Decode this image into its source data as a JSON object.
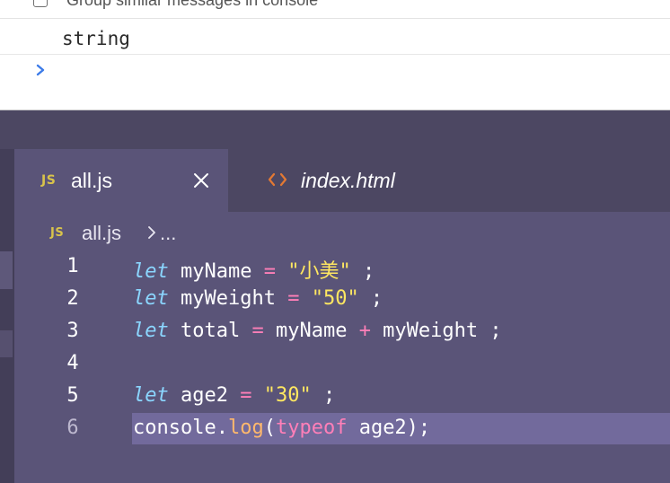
{
  "console": {
    "group_similar_label": "Group similar messages in console",
    "output_text": "string"
  },
  "editor": {
    "tabs": [
      {
        "badge": "JS",
        "label": "all.js",
        "active": true
      },
      {
        "label": "index.html",
        "active": false
      }
    ],
    "breadcrumb": {
      "badge": "JS",
      "file": "all.js",
      "more": "..."
    },
    "lines": [
      {
        "number": "1",
        "tokens": [
          {
            "t": "let",
            "c": "kw"
          },
          {
            "t": " myName ",
            "c": "plain"
          },
          {
            "t": "=",
            "c": "op"
          },
          {
            "t": " ",
            "c": "plain"
          },
          {
            "t": "\"小美\"",
            "c": "str"
          },
          {
            "t": " ;",
            "c": "plain"
          }
        ]
      },
      {
        "number": "2",
        "tokens": [
          {
            "t": "let",
            "c": "kw"
          },
          {
            "t": " myWeight ",
            "c": "plain"
          },
          {
            "t": "=",
            "c": "op"
          },
          {
            "t": " ",
            "c": "plain"
          },
          {
            "t": "\"50\"",
            "c": "str"
          },
          {
            "t": " ;",
            "c": "plain"
          }
        ]
      },
      {
        "number": "3",
        "tokens": [
          {
            "t": "let",
            "c": "kw"
          },
          {
            "t": " total ",
            "c": "plain"
          },
          {
            "t": "=",
            "c": "op"
          },
          {
            "t": " myName ",
            "c": "plain"
          },
          {
            "t": "+",
            "c": "op"
          },
          {
            "t": " myWeight ;",
            "c": "plain"
          }
        ]
      },
      {
        "number": "4",
        "tokens": []
      },
      {
        "number": "5",
        "tokens": [
          {
            "t": "let",
            "c": "kw"
          },
          {
            "t": " age2 ",
            "c": "plain"
          },
          {
            "t": "=",
            "c": "op"
          },
          {
            "t": " ",
            "c": "plain"
          },
          {
            "t": "\"30\"",
            "c": "str"
          },
          {
            "t": " ;",
            "c": "plain"
          }
        ]
      },
      {
        "number": "6",
        "current": true,
        "tokens": [
          {
            "t": "console.",
            "c": "plain"
          },
          {
            "t": "log",
            "c": "fn"
          },
          {
            "t": "(",
            "c": "plain"
          },
          {
            "t": "typeof",
            "c": "typeof"
          },
          {
            "t": " age2);",
            "c": "plain"
          }
        ]
      }
    ]
  },
  "colors": {
    "editor_bg": "#5a5478",
    "current_line": "#726a9c",
    "keyword": "#8bd6ff",
    "string": "#ffe761",
    "operator": "#ff7fb8",
    "js_badge": "#d8c34b",
    "html_icon": "#e37933"
  },
  "icons": [
    "checkbox-icon",
    "prompt-chevron-icon",
    "close-icon",
    "html-file-icon",
    "chevron-right-icon"
  ]
}
